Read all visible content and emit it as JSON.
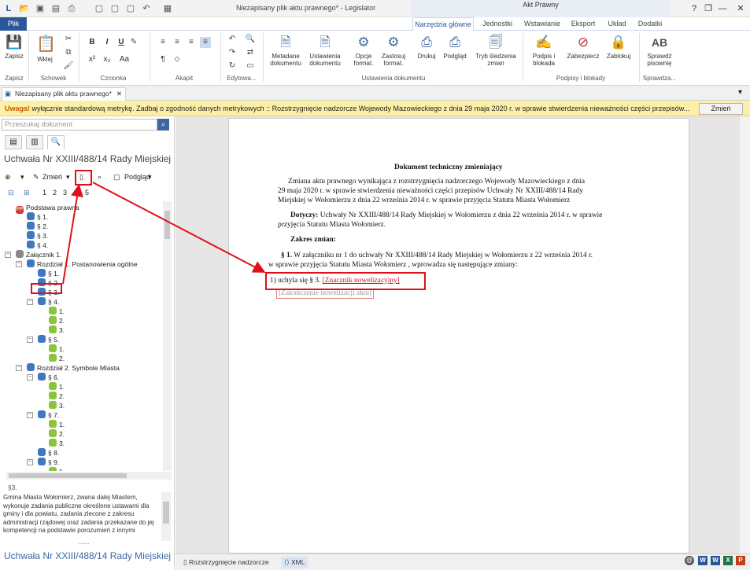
{
  "titlebar": {
    "title": "Niezapisany plik aktu prawnego* - Legislator",
    "context_title": "Akt Prawny",
    "help": "?",
    "restore": "❐",
    "minimize": "—",
    "maximize": "☐",
    "close": "✕"
  },
  "tabs": {
    "file": "Plik",
    "items": [
      "Narzędzia główne",
      "Jednostki",
      "Wstawianie",
      "Eksport",
      "Układ",
      "Dodatki"
    ]
  },
  "ribbon": {
    "save": "Zapisz",
    "paste": "Wklej",
    "metadata": "Metadane dokumentu",
    "doc_settings": "Ustawienia dokumentu",
    "format_options": "Opcje format.",
    "apply_format": "Zastosuj format.",
    "print": "Drukuj",
    "preview": "Podgląd",
    "track_mode": "Tryb śledzenia zmian",
    "sign_lock": "Podpis i blokada",
    "protect": "Zabezpiecz",
    "locked": "Zablokuj",
    "spellcheck": "Sprawdź pisownię",
    "groups": {
      "save": "Zapisz",
      "clipboard": "Schowek",
      "font": "Czcionka",
      "paragraph": "Akapit",
      "editing": "Edytowa...",
      "doc_settings": "Ustawienia dokumentu",
      "signatures": "Podpisy i blokady",
      "spelling": "Sprawdza..."
    },
    "font_buttons": {
      "bold": "B",
      "italic": "I",
      "underline": "U",
      "super": "x²",
      "sub": "x₂",
      "case": "Aa"
    }
  },
  "doc_tab": {
    "label": "Niezapisany plik aktu prawnego*",
    "close": "✕"
  },
  "warning": {
    "bold": "Uwaga!",
    "text": " wyłącznie standardową metrykę. Zadbaj o zgodność danych metrykowych :: Rozstrzygnięcie nadzorcze Wojewody Mazowieckiego z dnia 29 maja 2020 r. w sprawie stwierdzenia nieważności części przepisów...",
    "button": "Zmień"
  },
  "left_panel": {
    "search_placeholder": "Przeszukaj dokument",
    "title": "Uchwała Nr XXIII/488/14 Rady Miejskiej w Wołomierzu",
    "zmien": "Zmień",
    "podglad": "Podgląd",
    "levels": [
      "1",
      "2",
      "3",
      "4",
      "5"
    ],
    "tree": [
      {
        "label": "Podstawa prawna",
        "icon": "PP"
      },
      {
        "label": "§ 1."
      },
      {
        "label": "§ 2."
      },
      {
        "label": "§ 3."
      },
      {
        "label": "§ 4."
      },
      {
        "label": "Załącznik 1."
      },
      {
        "label": "Rozdział 1. Postanowienia ogólne"
      },
      {
        "label": "§ 1."
      },
      {
        "label": "§ 2."
      },
      {
        "label": "§ 3."
      },
      {
        "label": "§ 4."
      },
      {
        "label": "1."
      },
      {
        "label": "2."
      },
      {
        "label": "3."
      },
      {
        "label": "§ 5."
      },
      {
        "label": "1."
      },
      {
        "label": "2."
      },
      {
        "label": "Rozdział 2. Symbole Miasta"
      },
      {
        "label": "§ 6."
      },
      {
        "label": "1."
      },
      {
        "label": "2."
      },
      {
        "label": "3."
      },
      {
        "label": "§ 7."
      },
      {
        "label": "1."
      },
      {
        "label": "2."
      },
      {
        "label": "3."
      },
      {
        "label": "§ 8."
      },
      {
        "label": "§ 9."
      },
      {
        "label": "1."
      }
    ],
    "preview_label": "§3.",
    "preview_text": "Gmina Miasta Wołomierz, zwana dalej Miastem, wykonuje zadania publiczne określone ustawami dla gminy i dla powiatu, zadania zlecone z zakresu administracji rządowej oraz zadania przekazane do jej kompetencji na podstawie porozumień z innymi",
    "dots": "......",
    "footer_title": "Uchwała Nr XXIII/488/14 Rady Miejskiej w Wołomierzu"
  },
  "document": {
    "heading": "Dokument techniczny zmieniający",
    "intro_1": "Zmiana aktu prawnego wynikająca z rozstrzygnięcia nadzorczego Wojewody Mazowieckiego z dnia",
    "intro_2": "29 maja 2020 r. w sprawie stwierdzenia nieważności części przepisów Uchwały Nr XXIII/488/14 Rady",
    "intro_3": "Miejskiej w Wołomierzu z dnia 22 września 2014 r. w sprawie przyjęcia Statutu Miasta Wołomierz",
    "dotyczy_label": "Dotyczy:",
    "dotyczy_1": " Uchwały Nr XXIII/488/14 Rady Miejskiej w Wołomierzu z dnia 22 września 2014 r. w sprawie",
    "dotyczy_2": "przyjęcia Statutu Miasta Wołomierz.",
    "zakres": "Zakres zmian:",
    "par_label": "§ 1.",
    "par_1": " W załączniku nr 1 do uchwały Nr XXIII/488/14 Rady Miejskiej w Wołomierzu z  22 września 2014 r.",
    "par_2": "w sprawie przyjęcia Statutu Miasta Wołomierz , wprowadza się następujące zmiany:",
    "item": "1) uchyla się § 3.",
    "marker": "[Znacznik nowelizacyjny]",
    "end_marker": "[Zakończenie nowelizacji aktu]"
  },
  "statusbar": {
    "tab1": "Rozstrzygnięcie nadzorcze",
    "tab2": "XML",
    "apps": [
      "@",
      "W",
      "W",
      "X",
      "P"
    ]
  },
  "colors": {
    "accent": "#2b579a",
    "highlight": "#e0101a",
    "warning_bg": "#fcf0a8",
    "marker": "#d0101a"
  }
}
